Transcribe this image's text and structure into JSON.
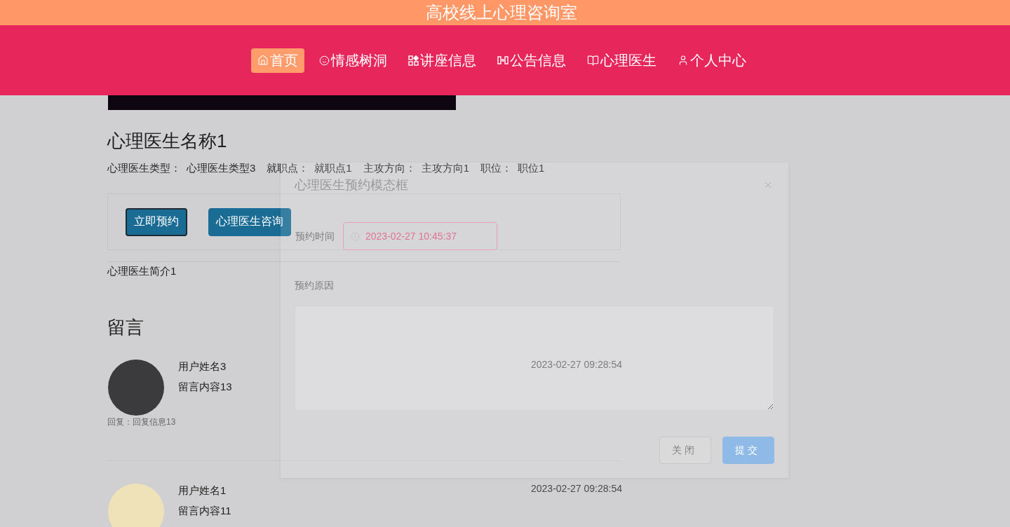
{
  "header": {
    "title": "高校线上心理咨询室"
  },
  "nav": [
    {
      "label": "首页",
      "selected": true
    },
    {
      "label": "情感树洞",
      "selected": false
    },
    {
      "label": "讲座信息",
      "selected": false
    },
    {
      "label": "公告信息",
      "selected": false
    },
    {
      "label": "心理医生",
      "selected": false
    },
    {
      "label": "个人中心",
      "selected": false
    }
  ],
  "doctor": {
    "name": "心理医生名称1",
    "details": [
      {
        "label": "心理医生类型：",
        "value": "心理医生类型3"
      },
      {
        "label": "就职点：",
        "value": "就职点1"
      },
      {
        "label": "主攻方向：",
        "value": "主攻方向1"
      },
      {
        "label": "职位：",
        "value": "职位1"
      }
    ],
    "actions": [
      {
        "label": "立即预约",
        "focused": true
      },
      {
        "label": "心理医生咨询",
        "focused": false
      }
    ],
    "intro": "心理医生简介1"
  },
  "comments": {
    "title": "留言",
    "items": [
      {
        "user": "用户姓名3",
        "content": "留言内容13",
        "time": "2023-02-27 09:28:54",
        "reply": "回复：回复信息13"
      },
      {
        "user": "用户姓名1",
        "content": "留言内容11",
        "time": "2023-02-27 09:28:54"
      }
    ]
  },
  "modal": {
    "title": "心理医生预约模态框",
    "fields": [
      {
        "kind": "datetime",
        "label": "预约时间",
        "value": "2023-02-27 10:45:37"
      },
      {
        "kind": "textarea",
        "label": "预约原因"
      }
    ],
    "buttons": [
      {
        "kind": "default",
        "label": "关闭"
      },
      {
        "kind": "primary",
        "label": "提交"
      }
    ]
  }
}
